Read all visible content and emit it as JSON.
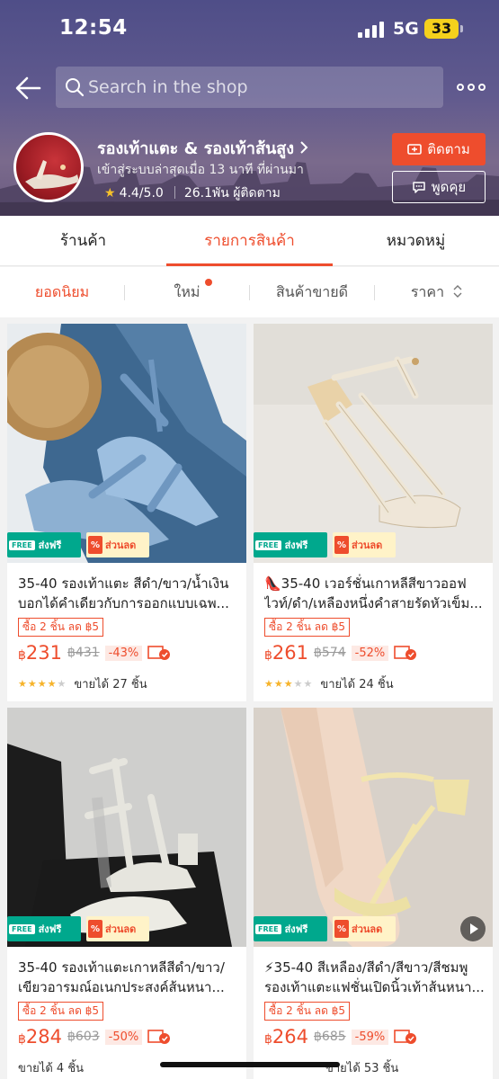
{
  "status_bar": {
    "time": "12:54",
    "network": "5G",
    "battery": "33"
  },
  "header": {
    "search_placeholder": "Search in the shop",
    "shop_name": "รองเท้าแตะ & รองเท้าส้นสูง",
    "last_active": "เข้าสู่ระบบล่าสุดเมื่อ 13 นาที ที่ผ่านมา",
    "rating": "4.4/5.0",
    "followers": "26.1พัน ผู้ติดตาม",
    "follow_label": "ติดตาม",
    "chat_label": "พูดคุย"
  },
  "tabs": [
    {
      "label": "ร้านค้า",
      "active": false
    },
    {
      "label": "รายการสินค้า",
      "active": true
    },
    {
      "label": "หมวดหมู่",
      "active": false
    }
  ],
  "sort_options": [
    {
      "label": "ยอดนิยม",
      "active": true
    },
    {
      "label": "ใหม่",
      "active": false
    },
    {
      "label": "สินค้าขายดี",
      "active": false
    },
    {
      "label": "ราคา",
      "active": false
    }
  ],
  "badges": {
    "free_label": "FREE",
    "free_ship": "ส่งฟรี",
    "discount": "ส่วนลด"
  },
  "products": [
    {
      "title": "35-40 รองเท้าแตะ สีดำ/ขาว/น้ำเงิน บอกได้คำเดียวกับการออกแบบเฉพ...",
      "tag": "ซื้อ 2 ชิ้น ลด ฿5",
      "price": "231",
      "currency": "฿",
      "original_price": "฿431",
      "discount": "-43%",
      "rating_stars": 4,
      "sold": "ขายได้ 27 ชิ้น"
    },
    {
      "title": "👠35-40 เวอร์ชั่นเกาหลีสีขาวออฟไวท์/ดำ/เหลืองหนึ่งคำสายรัดหัวเข็ม...",
      "tag": "ซื้อ 2 ชิ้น ลด ฿5",
      "price": "261",
      "currency": "฿",
      "original_price": "฿574",
      "discount": "-52%",
      "rating_stars": 3,
      "sold": "ขายได้ 24 ชิ้น"
    },
    {
      "title": "35-40 รองเท้าแตะเกาหลีสีดำ/ขาว/เขียวอารมณ์อเนกประสงค์ส้นหนา...",
      "tag": "ซื้อ 2 ชิ้น ลด ฿5",
      "price": "284",
      "currency": "฿",
      "original_price": "฿603",
      "discount": "-50%",
      "rating_stars": 0,
      "sold": "ขายได้ 4 ชิ้น"
    },
    {
      "title": "⚡35-40 สีเหลือง/สีดำ/สีขาว/สีชมพูรองเท้าแตะแฟชั่นเปิดนิ้วเท้าส้นหนา...",
      "tag": "ซื้อ 2 ชิ้น ลด ฿5",
      "price": "264",
      "currency": "฿",
      "original_price": "฿685",
      "discount": "-59%",
      "rating_stars": 0,
      "sold": "ขายได้ 53 ชิ้น"
    }
  ]
}
